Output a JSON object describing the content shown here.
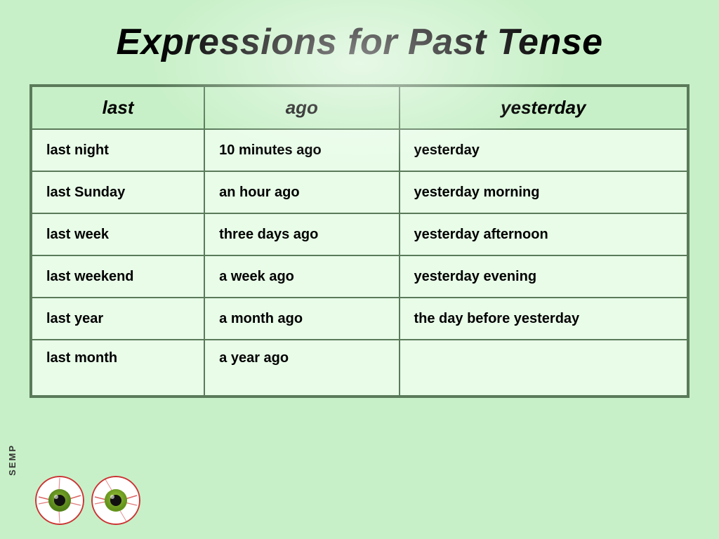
{
  "title": "Expressions for Past Tense",
  "semp": "SEMP",
  "table": {
    "headers": [
      "last",
      "ago",
      "yesterday"
    ],
    "rows": [
      [
        "last night",
        "10 minutes ago",
        "yesterday"
      ],
      [
        "last Sunday",
        "an hour ago",
        "yesterday morning"
      ],
      [
        "last week",
        "three days ago",
        "yesterday afternoon"
      ],
      [
        "last weekend",
        "a week ago",
        "yesterday evening"
      ],
      [
        "last year",
        "a month ago",
        "the day before yesterday"
      ],
      [
        "last month",
        "a year ago",
        ""
      ]
    ]
  }
}
